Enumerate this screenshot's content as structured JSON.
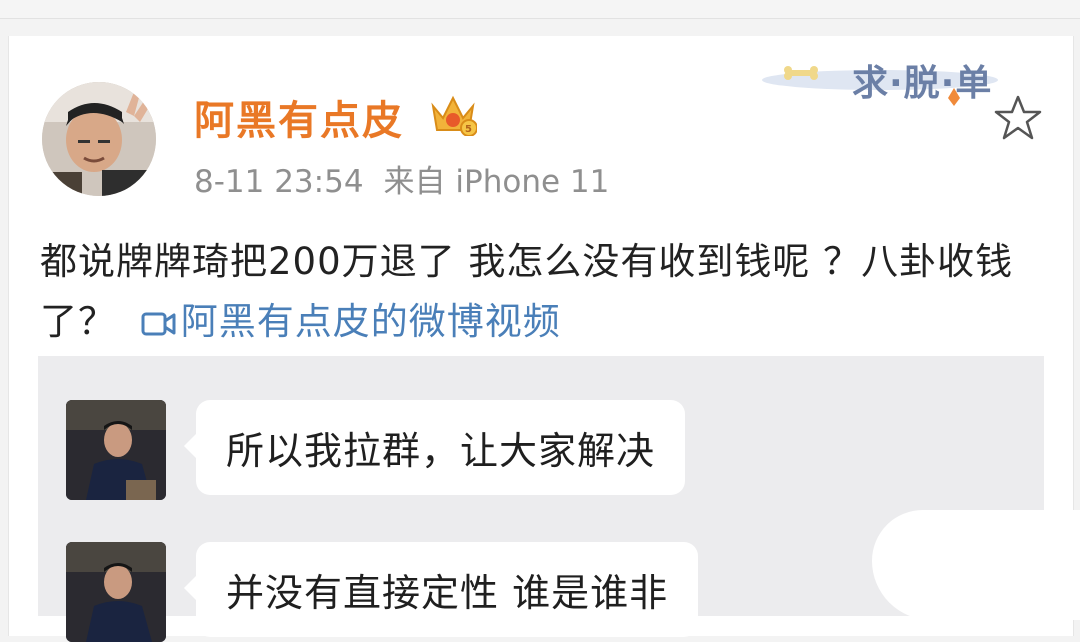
{
  "post": {
    "username": "阿黑有点皮",
    "timestamp": "8-11 23:54",
    "source": "来自 iPhone 11",
    "text": "都说牌牌琦把200万退了 我怎么没有收到钱呢 ？八卦收钱了？",
    "video_link": "阿黑有点皮的微博视频",
    "badge_text": "求·脱·单",
    "accent_color": "#e97826",
    "link_color": "#4a7fb8"
  },
  "chat": {
    "messages": [
      {
        "text": "所以我拉群，让大家解决"
      },
      {
        "text": "并没有直接定性 谁是谁非"
      }
    ]
  },
  "icons": {
    "crown": "crown-vip-icon",
    "star": "favorite-star-icon",
    "video": "video-camera-icon"
  }
}
